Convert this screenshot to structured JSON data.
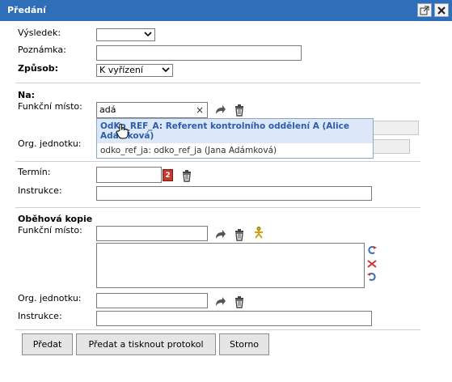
{
  "window": {
    "title": "Předání",
    "popout_icon": "popout-icon",
    "close_icon": "close-icon"
  },
  "form": {
    "vysledek_label": "Výsledek:",
    "poznamka_label": "Poznámka:",
    "zpusob_label": "Způsob:",
    "zpusob_value": "K vyřízení",
    "na_heading": "Na:",
    "funkcni_misto_label": "Funkční místo:",
    "funkcni_misto_value": "adá",
    "clear_symbol": "×",
    "org_jednotku_label": "Org. jednotku:",
    "termin_label": "Termín:",
    "calendar_number": "2",
    "instrukce_label": "Instrukce:",
    "obehova_heading": "Oběhová kopie",
    "copy_funkcni_misto_label": "Funkční místo:",
    "copy_org_jednotku_label": "Org. jednotku:",
    "copy_instrukce_label": "Instrukce:"
  },
  "autocomplete": {
    "options": [
      {
        "line1": "OdKo_REF_A: Referent kontrolního oddělení A (Alice",
        "line2": "Adámková)"
      },
      {
        "line1": "odko_ref_ja: odko_ref_ja (Jana Adámková)"
      }
    ]
  },
  "buttons": {
    "predat": "Předat",
    "predat_tisk": "Předat a tisknout protokol",
    "storno": "Storno"
  },
  "colors": {
    "title_bar": "#2f6eb8",
    "selection": "#dce8f8",
    "option_text": "#2a5db0"
  }
}
